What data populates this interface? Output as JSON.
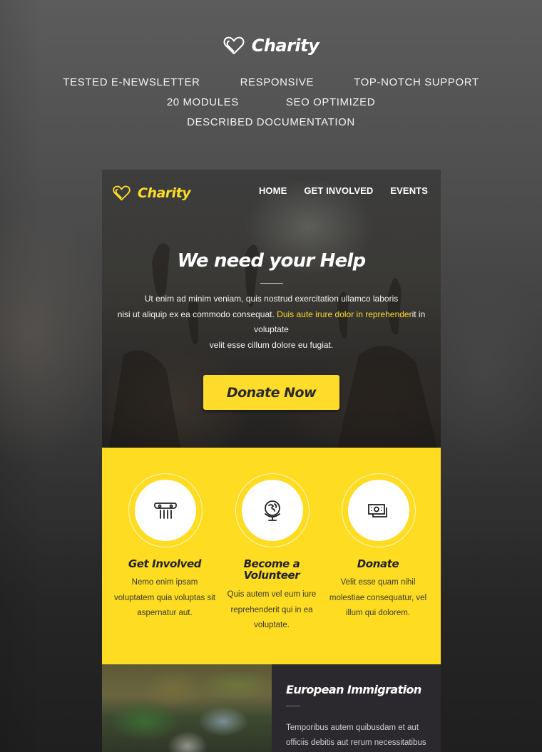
{
  "promo": {
    "brand": "Charity",
    "features_row1": [
      "TESTED E-NEWSLETTER",
      "RESPONSIVE",
      "TOP-NOTCH SUPPORT"
    ],
    "features_row2": [
      "20 MODULES",
      "SEO OPTIMIZED"
    ],
    "features_row3": [
      "DESCRIBED DOCUMENTATION"
    ]
  },
  "email": {
    "nav": {
      "brand": "Charity",
      "links": [
        "HOME",
        "GET INVOLVED",
        "EVENTS"
      ]
    },
    "hero": {
      "title": "We need your Help",
      "line1": "Ut enim ad minim veniam, quis nostrud exercitation ullamco laboris",
      "line2_pre": "nisi ut aliquip ex ea commodo consequat. ",
      "line2_highlight": "Duis aute irure dolor in reprehender",
      "line2_post": "it in voluptate",
      "line3": "velit esse cillum dolore eu fugiat.",
      "button": "Donate Now"
    },
    "features": [
      {
        "icon": "column-icon",
        "title": "Get Involved",
        "text": "Nemo enim ipsam voluptatem quia voluptas sit aspernatur aut."
      },
      {
        "icon": "globe-icon",
        "title": "Become a Volunteer",
        "text": "Quis autem vel eum iure reprehenderit qui in ea voluptate."
      },
      {
        "icon": "money-icon",
        "title": "Donate",
        "text": "Velit esse quam nihil molestiae consequatur, vel illum qui dolorem."
      }
    ],
    "article": {
      "title": "European Immigration",
      "text": "Temporibus autem quibusdam et aut officiis debitis aut rerum necessitatibus"
    }
  },
  "colors": {
    "accent": "#fddc22",
    "dark": "#2b292d"
  }
}
